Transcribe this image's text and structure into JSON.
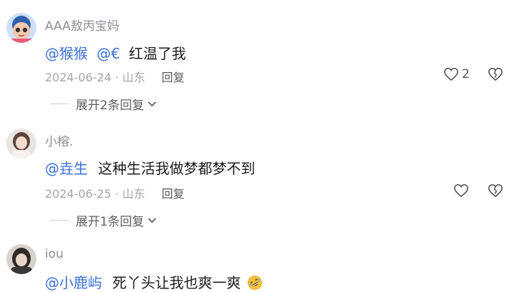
{
  "comments": [
    {
      "username": "AAA敖丙宝妈",
      "mentions": [
        "@猴猴",
        "@€"
      ],
      "text": "红温了我",
      "date": "2024-06-24",
      "location": "山东",
      "reply_label": "回复",
      "like_count": "2",
      "expand_label": "展开2条回复"
    },
    {
      "username": "小榕.",
      "mentions": [
        "@垚生"
      ],
      "text": "这种生活我做梦都梦不到",
      "date": "2024-06-25",
      "location": "山东",
      "reply_label": "回复",
      "like_count": "",
      "expand_label": "展开1条回复"
    },
    {
      "username": "iou",
      "mentions": [
        "@小鹿屿"
      ],
      "text": "死丫头让我也爽一爽",
      "emoji": "rolling-on-floor-laughing-emoji"
    }
  ],
  "separator": "·",
  "icons": [
    "heart-icon",
    "broken-heart-icon",
    "chevron-down-icon"
  ],
  "colors": {
    "mention": "#3a6fd8",
    "meta": "#a5a5aa",
    "username": "#8f8f94"
  }
}
